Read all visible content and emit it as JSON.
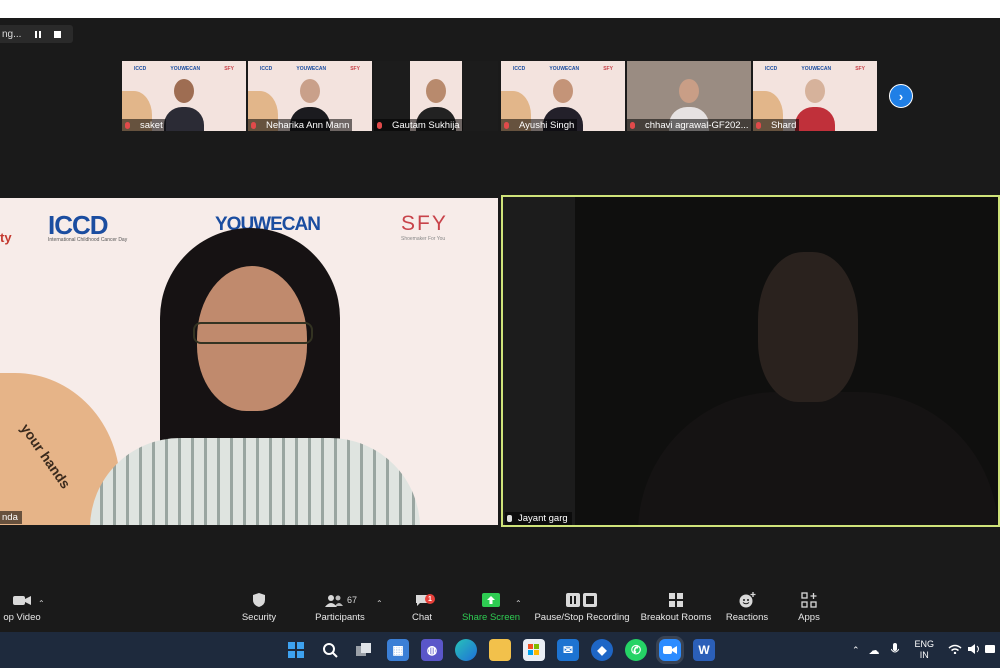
{
  "recording": {
    "status_text": "ng..."
  },
  "participants_strip": [
    {
      "name": "saket",
      "type": "bg"
    },
    {
      "name": "Neharika Ann Mann",
      "type": "bg"
    },
    {
      "name": "Gautam Sukhija",
      "type": "dark"
    },
    {
      "name": "Ayushi Singh",
      "type": "bg"
    },
    {
      "name": "chhavi agrawal-GF202...",
      "type": "room"
    },
    {
      "name": "Shard",
      "type": "bg"
    }
  ],
  "background_logos": {
    "icdd": "ICCD",
    "icdd_sub": "International Childhood Cancer Day",
    "ywc": "YOUWECAN",
    "sfy": "SFY",
    "sfy_sub": "Shoemaker For You",
    "left_fragment": "ty",
    "hand_text": "your hands"
  },
  "speakers": {
    "left_name": "nda",
    "right_name": "Jayant garg"
  },
  "toolbar": {
    "video_label": "op Video",
    "security_label": "Security",
    "participants_label": "Participants",
    "participants_count": "67",
    "chat_label": "Chat",
    "chat_badge": "1",
    "share_label": "Share Screen",
    "recording_label": "Pause/Stop Recording",
    "breakout_label": "Breakout Rooms",
    "reactions_label": "Reactions",
    "apps_label": "Apps"
  },
  "tray": {
    "lang_top": "ENG",
    "lang_bottom": "IN"
  },
  "colors": {
    "share_green": "#2ecc52",
    "active_border": "#cfe37a",
    "chat_badge": "#e8403a",
    "next_button": "#1f7fe6"
  }
}
